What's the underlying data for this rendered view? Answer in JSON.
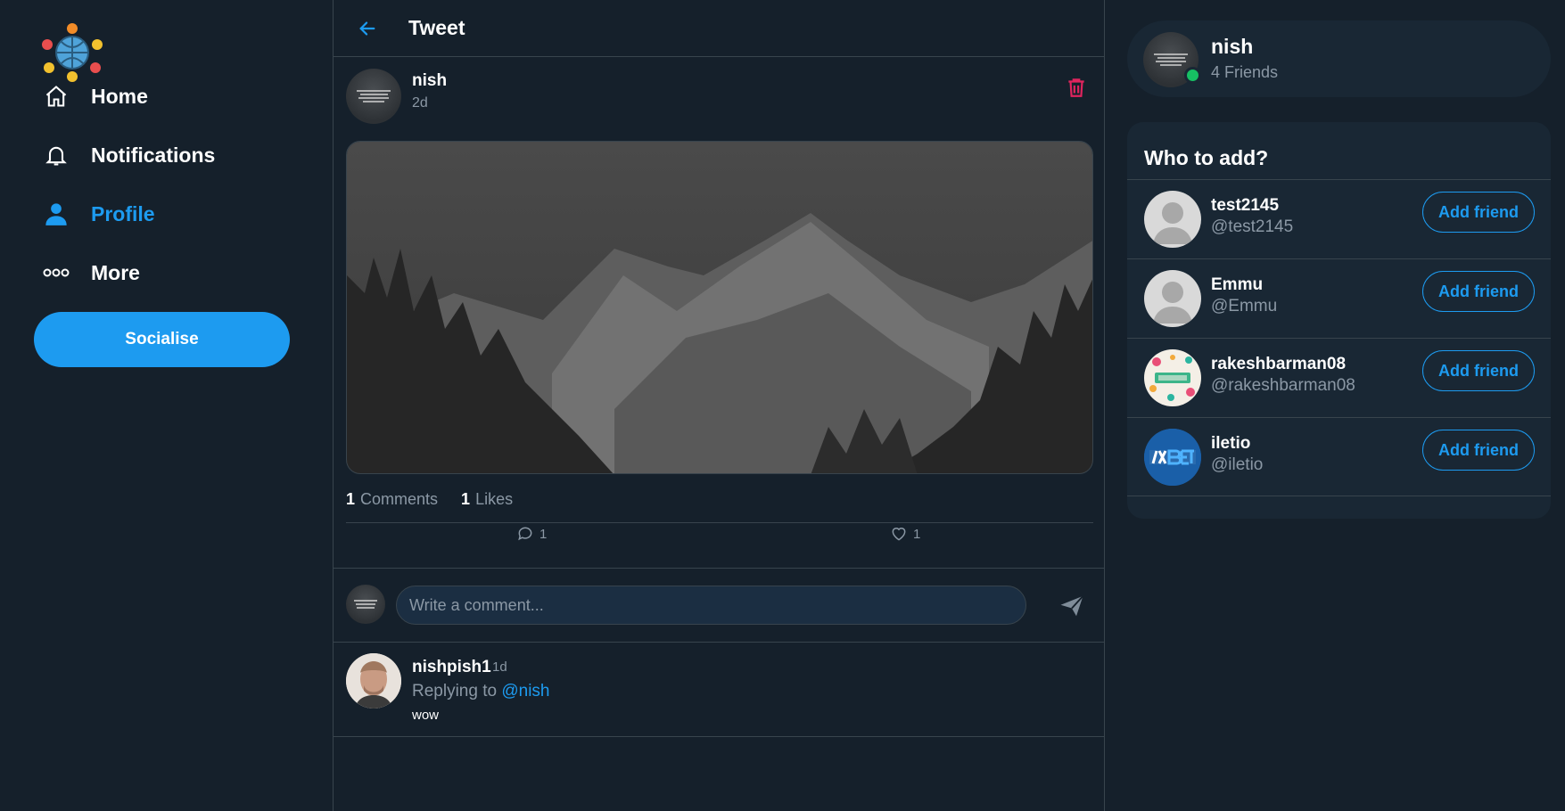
{
  "sidebar": {
    "nav": [
      {
        "label": "Home",
        "icon": "home-icon"
      },
      {
        "label": "Notifications",
        "icon": "bell-icon"
      },
      {
        "label": "Profile",
        "icon": "user-icon",
        "active": true
      },
      {
        "label": "More",
        "icon": "more-icon"
      }
    ],
    "cta_label": "Socialise"
  },
  "header": {
    "title": "Tweet"
  },
  "post": {
    "author": "nish",
    "time": "2d",
    "comments_count": "1",
    "comments_label": "Comments",
    "likes_count": "1",
    "likes_label": "Likes",
    "comment_action_count": "1",
    "like_action_count": "1"
  },
  "composer": {
    "placeholder": "Write a comment..."
  },
  "reply": {
    "author": "nishpish1",
    "time": "1d",
    "replying_prefix": "Replying to",
    "replying_handle": "@nish",
    "text": "wow"
  },
  "profile": {
    "name": "nish",
    "friends": "4 Friends"
  },
  "who_to_add": {
    "title": "Who to add?",
    "users": [
      {
        "name": "test2145",
        "handle": "@test2145",
        "button": "Add friend",
        "avatar": "default"
      },
      {
        "name": "Emmu",
        "handle": "@Emmu",
        "button": "Add friend",
        "avatar": "default"
      },
      {
        "name": "rakeshbarman08",
        "handle": "@rakeshbarman08",
        "button": "Add friend",
        "avatar": "pattern"
      },
      {
        "name": "iletio",
        "handle": "@iletio",
        "button": "Add friend",
        "avatar": "brand"
      }
    ]
  },
  "colors": {
    "accent": "#1d9bf0",
    "background": "#15202b",
    "card": "#192734",
    "danger": "#e0245e",
    "online": "#17bf63"
  }
}
